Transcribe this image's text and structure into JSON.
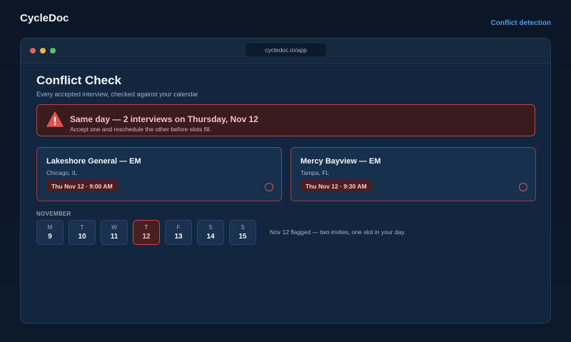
{
  "brand": "CycleDoc",
  "top_link": "Conflict detection",
  "window": {
    "url": "cycledoc.io/app"
  },
  "page": {
    "title": "Conflict Check",
    "subtitle": "Every accepted interview, checked against your calendar"
  },
  "alert": {
    "icon": "warning-triangle-icon",
    "title": "Same day — 2 interviews on Thursday, Nov 12",
    "description": "Accept one and reschedule the other before slots fill.",
    "color": "#b84646"
  },
  "interviews": [
    {
      "title": "Lakeshore General — EM",
      "location": "Chicago, IL",
      "time": "Thu Nov 12 · 9:00 AM"
    },
    {
      "title": "Mercy Bayview — EM",
      "location": "Tampa, FL",
      "time": "Thu Nov 12 · 9:30 AM"
    }
  ],
  "calendar": {
    "month": "NOVEMBER",
    "days": [
      {
        "letter": "M",
        "num": "9"
      },
      {
        "letter": "T",
        "num": "10"
      },
      {
        "letter": "W",
        "num": "11"
      },
      {
        "letter": "T",
        "num": "12",
        "flagged": true
      },
      {
        "letter": "F",
        "num": "13"
      },
      {
        "letter": "S",
        "num": "14"
      },
      {
        "letter": "S",
        "num": "15"
      }
    ],
    "note": "Nov 12 flagged — two invites, one slot in your day."
  }
}
